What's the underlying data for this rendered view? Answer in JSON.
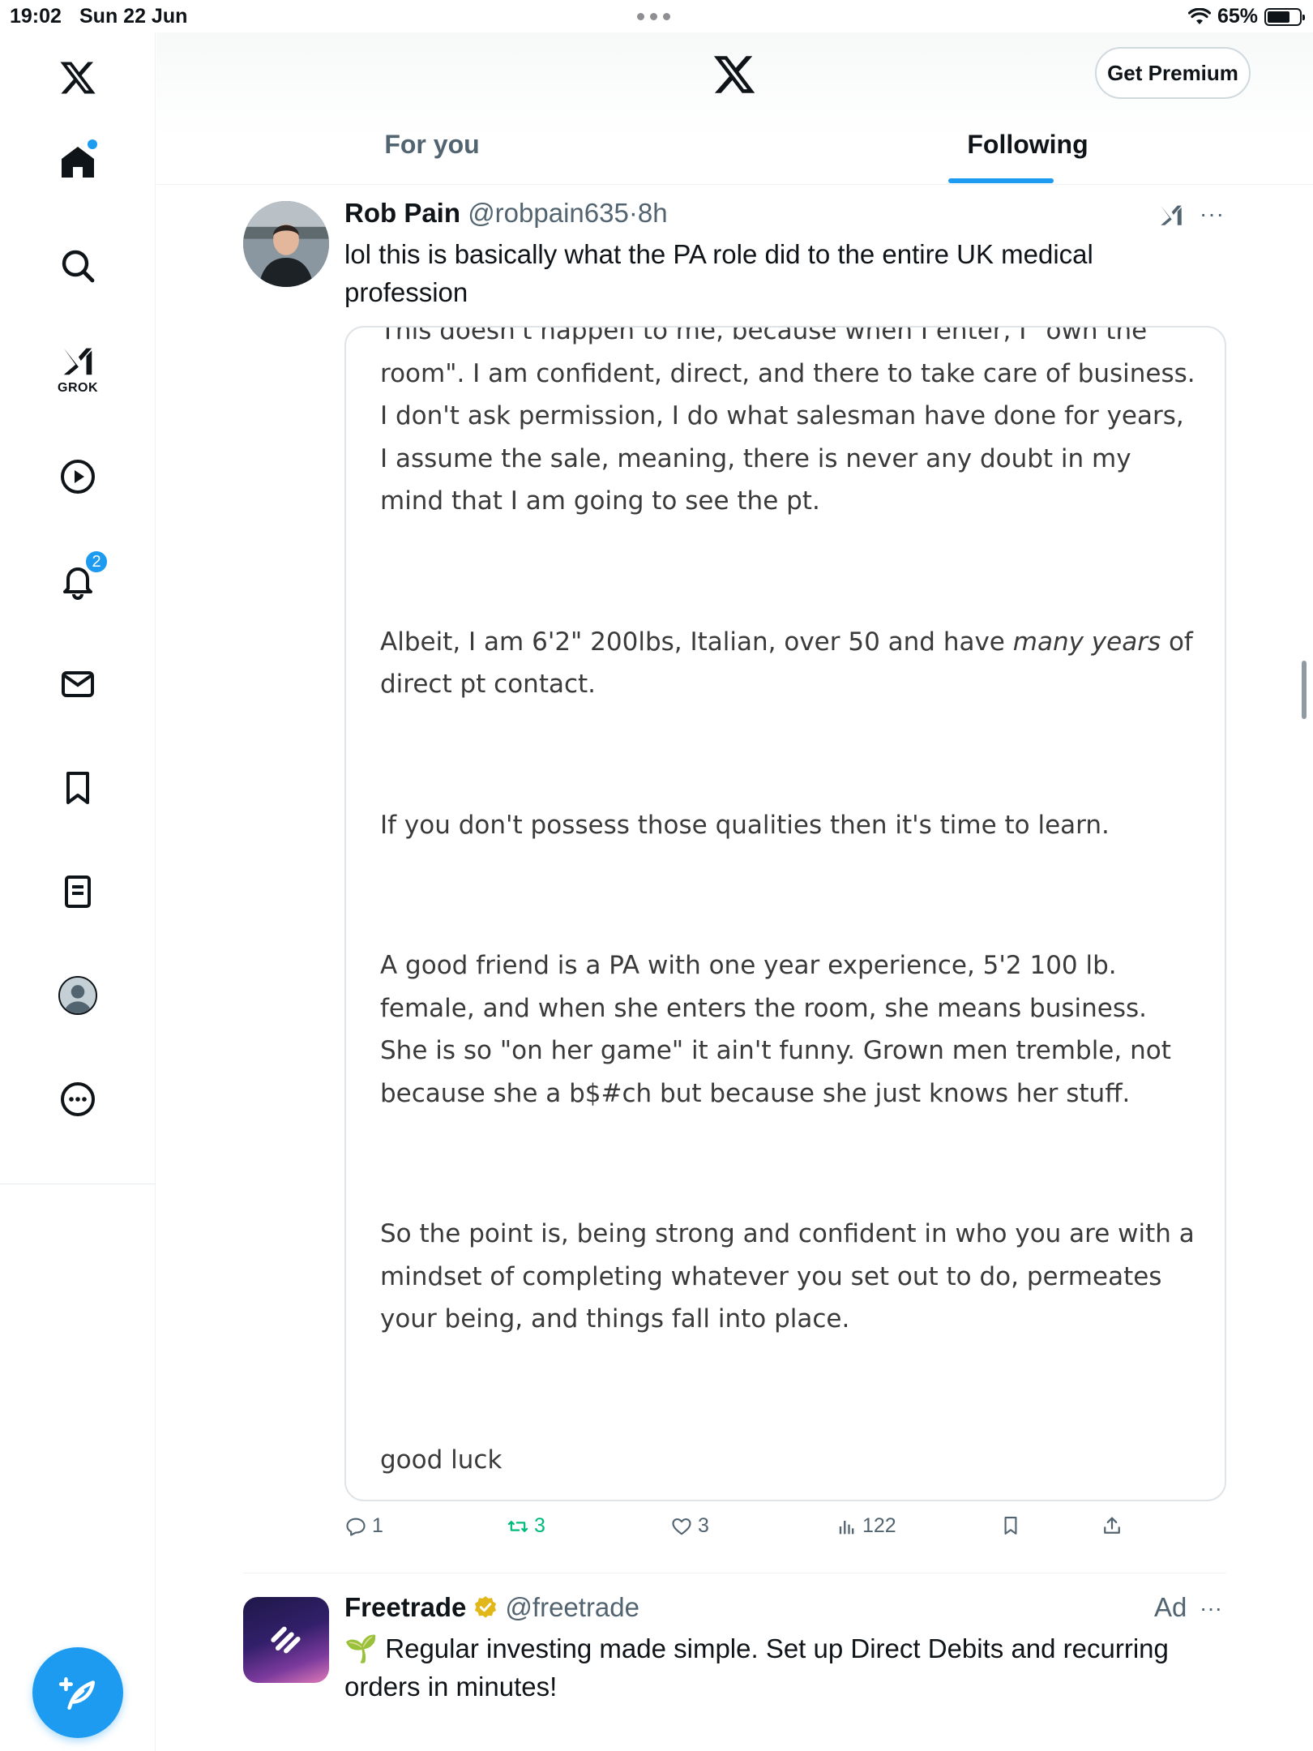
{
  "status_bar": {
    "time": "19:02",
    "date": "Sun 22 Jun",
    "battery": "65%"
  },
  "sidebar": {
    "grok_label": "GROK",
    "notifications_count": "2"
  },
  "header": {
    "premium_button": "Get Premium",
    "tabs": [
      {
        "label": "For you",
        "selected": false
      },
      {
        "label": "Following",
        "selected": true
      }
    ]
  },
  "post": {
    "name": "Rob Pain",
    "handle": "@robpain635",
    "separator": "·",
    "time": "8h",
    "text": "lol this is basically what the PA role did to the entire UK medical profession",
    "embed": {
      "p1": "This doesn't happen to me, because when I enter, I \"own the room\". I am confident, direct, and there to take care of business. I don't ask permission, I do what salesman have done for years, I assume the sale, meaning, there is never any doubt in my mind that I am going to see the pt.",
      "p2_start": "Albeit, I am 6'2\" 200lbs, Italian, over 50 and have ",
      "p2_em": "many years",
      "p2_end": " of direct pt contact.",
      "p3": "If you don't possess those qualities then it's time to learn.",
      "p4": "A good friend is a PA with one year experience, 5'2 100 lb. female, and when she enters the room, she means business. She is so \"on her game\" it ain't funny. Grown men tremble, not because she a b$#ch but because she just knows her stuff.",
      "p5": "So the point is, being strong and confident in who you are with a mindset of completing whatever you set out to do, permeates your being, and things fall into place.",
      "p6": "good luck"
    },
    "actions": {
      "replies": "1",
      "reposts": "3",
      "likes": "3",
      "views": "122"
    }
  },
  "ad": {
    "name": "Freetrade",
    "handle": "@freetrade",
    "label": "Ad",
    "emoji": "🌱",
    "text": "Regular investing made simple. Set up Direct Debits and recurring orders in minutes!"
  },
  "colors": {
    "accent": "#1d9bf0",
    "repost_green": "#00ba7c",
    "secondary_text": "#536471",
    "verified_gold": "#e2b719"
  }
}
